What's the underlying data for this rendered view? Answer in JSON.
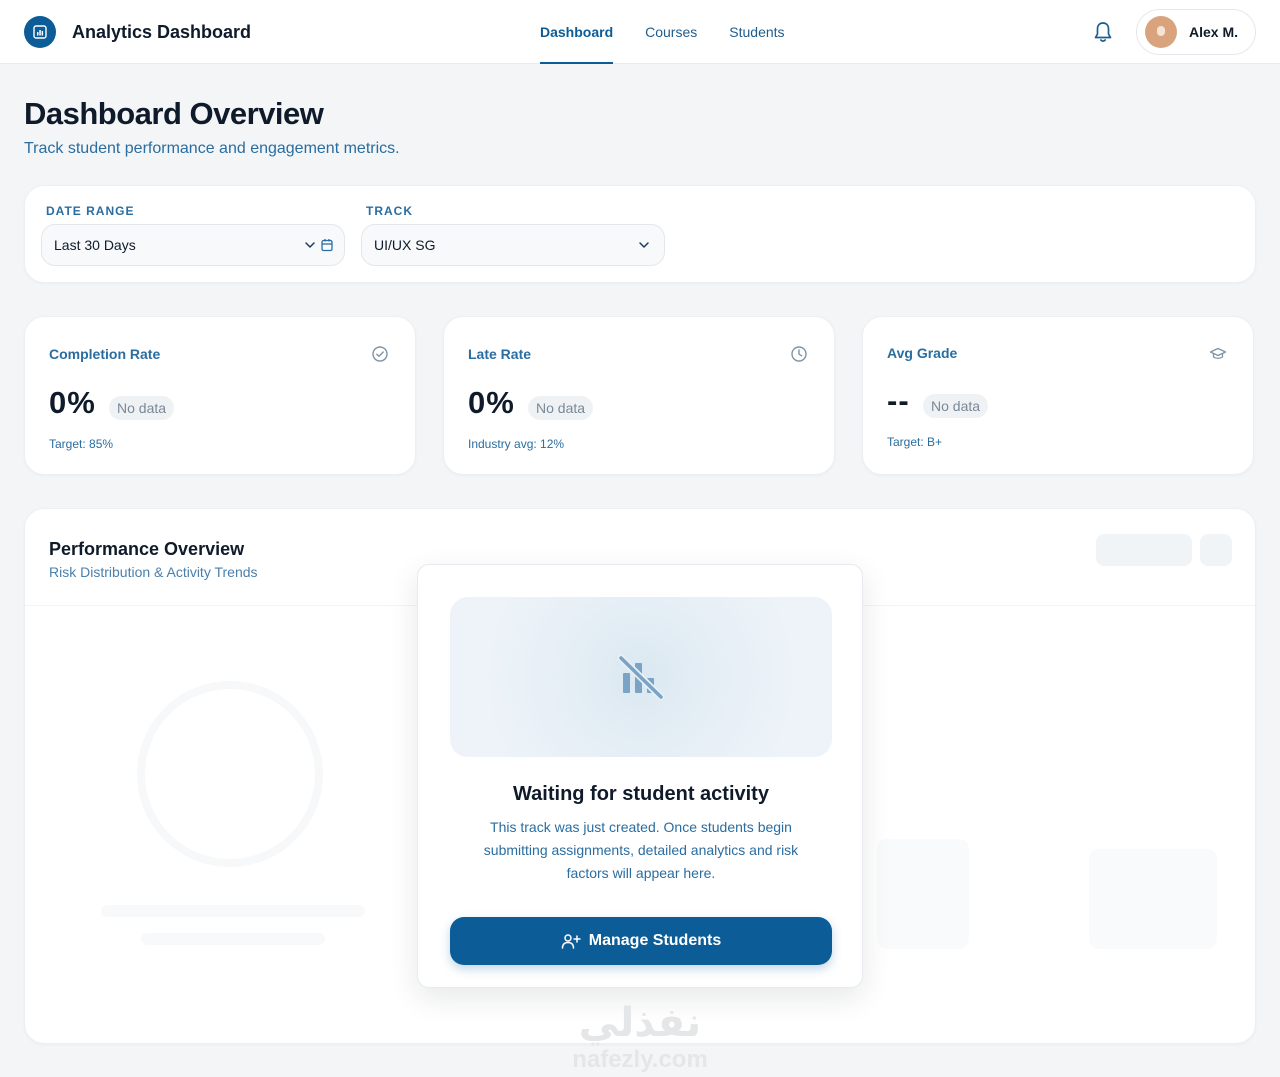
{
  "header": {
    "app_title": "Analytics Dashboard",
    "nav": [
      {
        "label": "Dashboard",
        "active": true
      },
      {
        "label": "Courses",
        "active": false
      },
      {
        "label": "Students",
        "active": false
      }
    ],
    "user_name": "Alex M."
  },
  "page": {
    "title": "Dashboard Overview",
    "subtitle": "Track student performance and engagement metrics."
  },
  "filters": {
    "date_range_label": "DATE RANGE",
    "date_range_value": "Last 30 Days",
    "track_label": "TRACK",
    "track_value": "UI/UX SG"
  },
  "metrics": [
    {
      "label": "Completion Rate",
      "value": "0%",
      "badge": "No data",
      "sub": "Target: 85%",
      "icon": "check-circle-icon"
    },
    {
      "label": "Late Rate",
      "value": "0%",
      "badge": "No data",
      "sub": "Industry avg: 12%",
      "icon": "clock-icon"
    },
    {
      "label": "Avg Grade",
      "value": "--",
      "badge": "No data",
      "sub": "Target: B+",
      "icon": "graduation-cap-icon"
    }
  ],
  "performance": {
    "title": "Performance Overview",
    "subtitle": "Risk Distribution & Activity Trends"
  },
  "empty_state": {
    "title": "Waiting for student activity",
    "body": "This track was just created. Once students begin submitting assignments, detailed analytics and risk factors will appear here.",
    "button_label": "Manage Students"
  },
  "watermark": {
    "arabic": "نفذلي",
    "latin": "nafezly.com"
  },
  "colors": {
    "brand": "#0b5c97",
    "accent_text": "#2a6da0",
    "background": "#f3f5f7"
  }
}
